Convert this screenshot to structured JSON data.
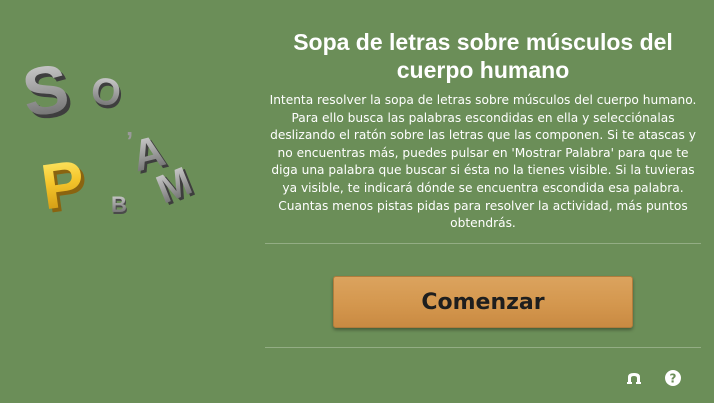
{
  "title": "Sopa de letras sobre músculos del cuerpo humano",
  "description": "Intenta resolver la sopa de letras sobre músculos del cuerpo humano. Para ello busca las palabras escondidas en ella y selecciónalas deslizando el ratón sobre las letras que las componen. Si te atascas y no encuentras más, puedes pulsar en 'Mostrar Palabra' para que te diga una palabra que buscar si ésta no la tienes visible. Si la tuvieras ya visible, te indicará dónde se encuentra escondida esa palabra. Cuantas menos pistas pidas para resolver la actividad, más puntos obtendrás.",
  "start_button": "Comenzar",
  "logo": {
    "icon": "word-search-logo",
    "letters": [
      "S",
      "O",
      "A",
      "M",
      "P",
      "B"
    ]
  },
  "toolbar": {
    "fullscreen_icon": "fullscreen-icon",
    "help_icon": "help-icon"
  },
  "colors": {
    "background": "#6b8e58",
    "button": "#d4974e",
    "text": "#ffffff",
    "letter_yellow": "#f2c230",
    "letter_gray": "#a8a8a8"
  }
}
